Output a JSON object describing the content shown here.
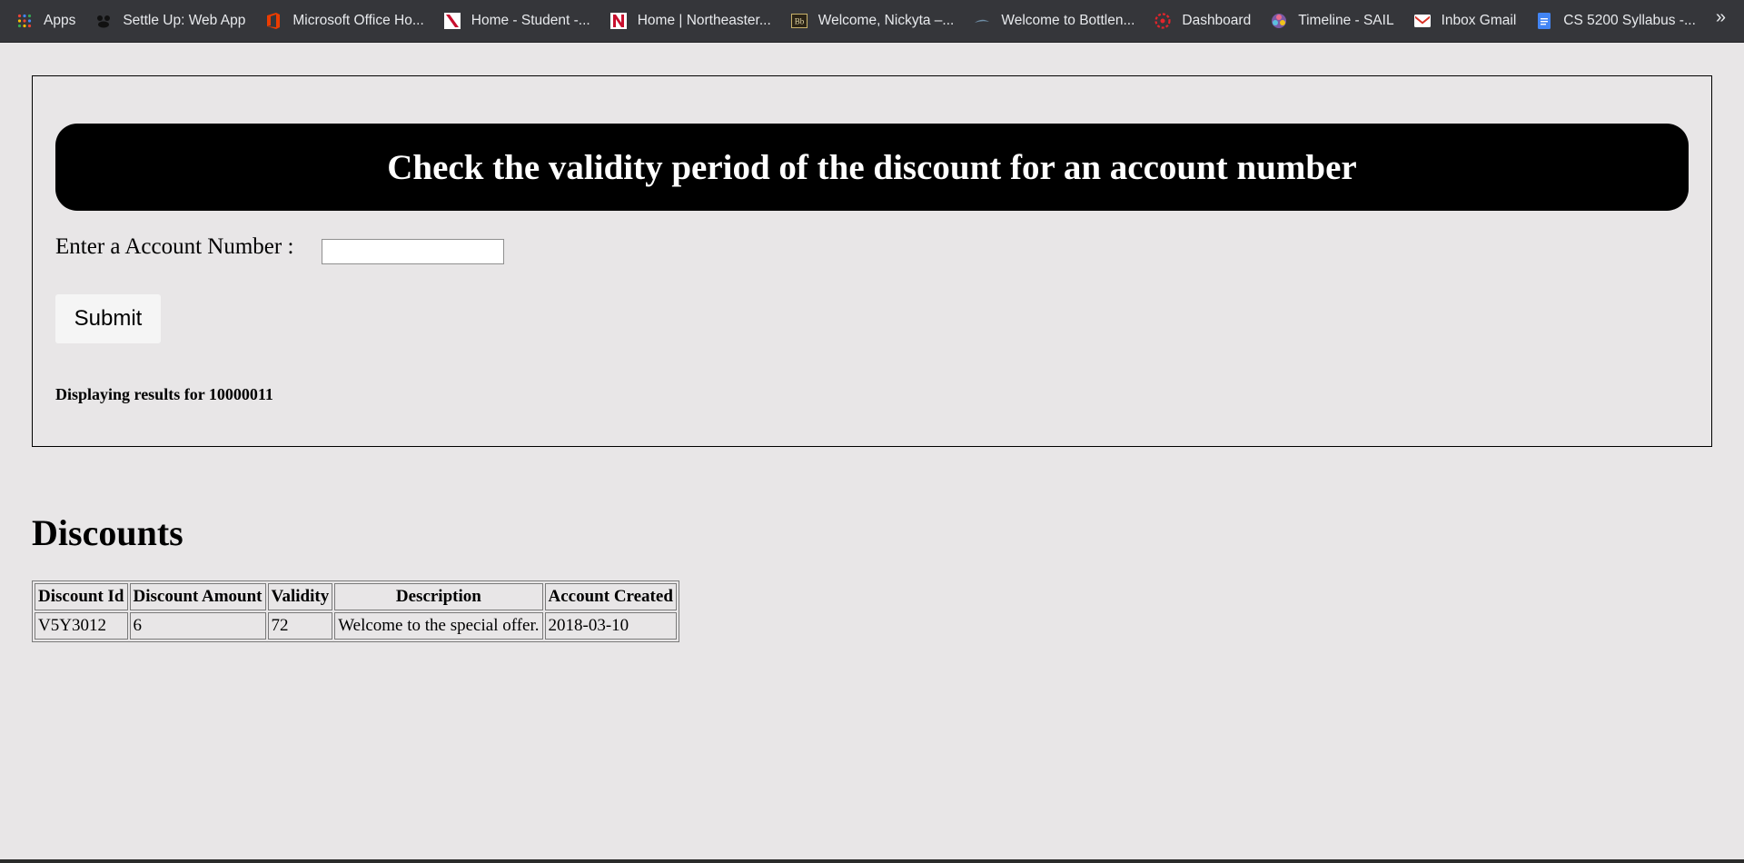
{
  "bookmarks": [
    {
      "label": "Apps",
      "icon": "apps-grid-icon"
    },
    {
      "label": "Settle Up: Web App",
      "icon": "settle-up-icon"
    },
    {
      "label": "Microsoft Office Ho...",
      "icon": "office-icon"
    },
    {
      "label": "Home - Student -...",
      "icon": "northeastern-icon"
    },
    {
      "label": "Home | Northeaster...",
      "icon": "northeastern-icon"
    },
    {
      "label": "Welcome, Nickyta –...",
      "icon": "blackboard-icon"
    },
    {
      "label": "Welcome to Bottlen...",
      "icon": "bottlenose-icon"
    },
    {
      "label": "Dashboard",
      "icon": "canvas-icon"
    },
    {
      "label": "Timeline - SAIL",
      "icon": "sail-icon"
    },
    {
      "label": "Inbox  Gmail",
      "icon": "gmail-icon"
    },
    {
      "label": "CS 5200 Syllabus -...",
      "icon": "google-docs-icon"
    }
  ],
  "bookmarks_more": "»",
  "form": {
    "heading": "Check the validity period of the discount for an account number",
    "account_label": "Enter a Account Number :",
    "account_value": "",
    "submit_label": "Submit",
    "results_text": "Displaying results for 10000011"
  },
  "discounts": {
    "title": "Discounts",
    "columns": [
      "Discount Id",
      "Discount Amount",
      "Validity",
      "Description",
      "Account Created"
    ],
    "rows": [
      [
        "V5Y3012",
        "6",
        "72",
        "Welcome to the special offer.",
        "2018-03-10"
      ]
    ]
  }
}
